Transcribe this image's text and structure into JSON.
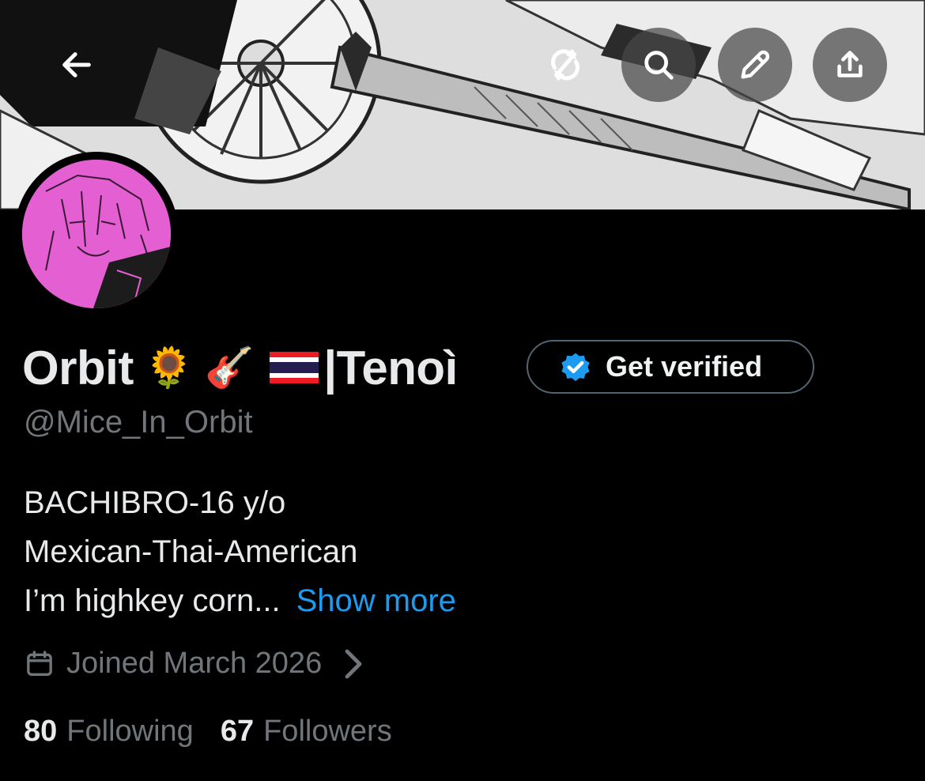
{
  "header": {
    "back_icon": "arrow-left-icon",
    "buttons": [
      {
        "icon": "sync-icon"
      },
      {
        "icon": "search-icon"
      },
      {
        "icon": "pencil-icon"
      },
      {
        "icon": "share-icon"
      }
    ]
  },
  "profile": {
    "display_name": "Orbit",
    "emoji_1": "🌻",
    "emoji_2": "🎸",
    "flag": "thailand-flag",
    "name_suffix": "|Tenoì",
    "handle": "@Mice_In_Orbit",
    "verify_label": "Get verified",
    "bio_lines": [
      "BACHIBRO-16 y/o",
      "Mexican-Thai-American",
      "I’m highkey corn..."
    ],
    "show_more": "Show more",
    "joined": "Joined March 2026",
    "following_count": "80",
    "following_label": "Following",
    "followers_count": "67",
    "followers_label": "Followers"
  },
  "colors": {
    "background": "#000000",
    "accent": "#1d9bf0",
    "muted": "#71767b",
    "avatar_bg": "#e35fd2"
  }
}
